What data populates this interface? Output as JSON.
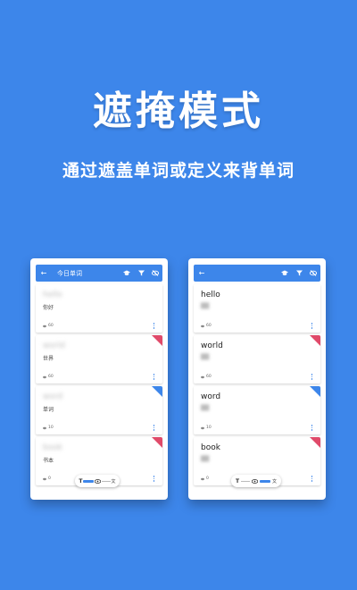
{
  "headline": "遮掩模式",
  "subline": "通过遮盖单词或定义来背单词",
  "colors": {
    "background": "#3d86ea",
    "accent": "#3d86ea",
    "tag_red": "#e04a6a"
  },
  "left_screen": {
    "appbar_title": "今日单词",
    "cards": [
      {
        "word": "hello",
        "meaning": "你好",
        "count": "60"
      },
      {
        "word": "world",
        "meaning": "世界",
        "count": "60"
      },
      {
        "word": "word",
        "meaning": "单词",
        "count": "10"
      },
      {
        "word": "book",
        "meaning": "书本",
        "count": "0"
      }
    ],
    "toolbar": {
      "text_icon": "T",
      "translate_icon": "文"
    }
  },
  "right_screen": {
    "cards": [
      {
        "word": "hello",
        "count": "60"
      },
      {
        "word": "world",
        "count": "60"
      },
      {
        "word": "word",
        "count": "10"
      },
      {
        "word": "book",
        "count": "0"
      }
    ],
    "toolbar": {
      "text_icon": "T",
      "translate_icon": "文"
    }
  },
  "icons": [
    "back-arrow-icon",
    "graduation-cap-icon",
    "filter-icon",
    "eye-off-icon",
    "eye-icon",
    "translate-icon",
    "more-vert-icon"
  ]
}
